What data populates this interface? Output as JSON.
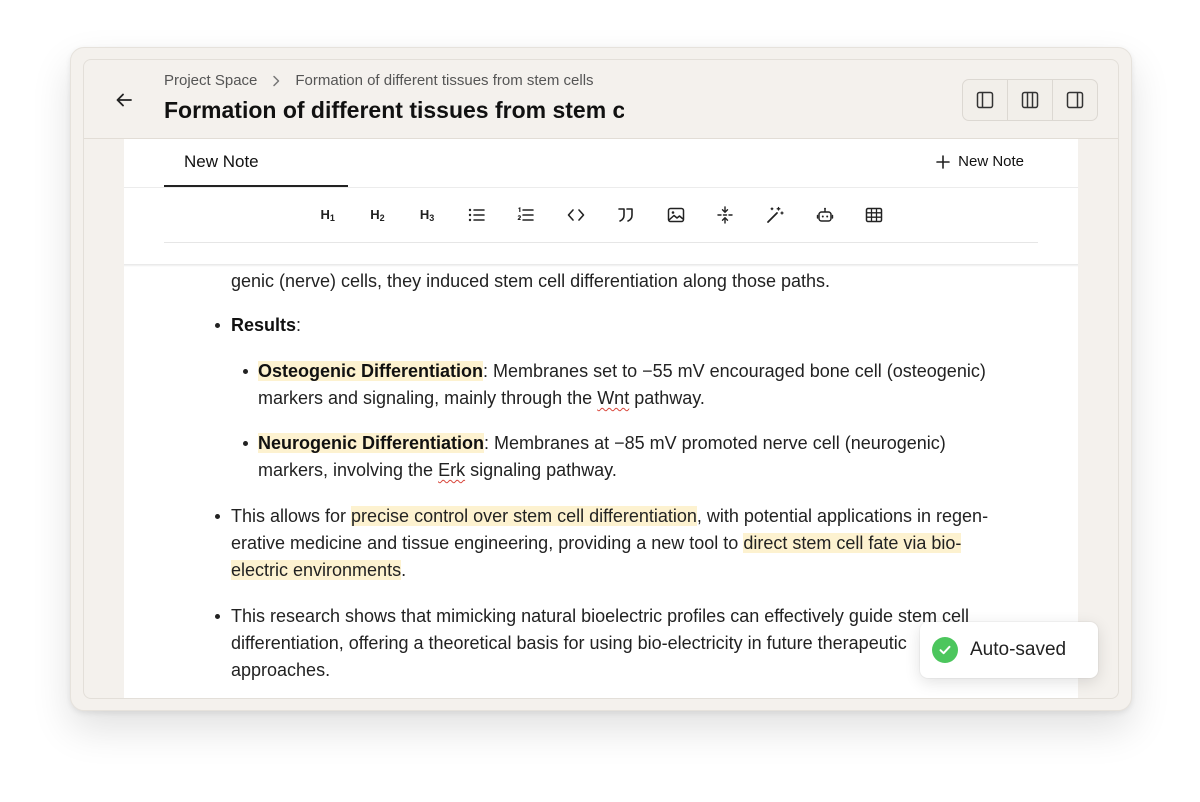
{
  "header": {
    "breadcrumb": [
      "Project Space",
      "Formation of different tissues from stem cells"
    ],
    "title": "Formation of different tissues from stem cells"
  },
  "layout_buttons": [
    "sidebar-left-icon",
    "columns-icon",
    "sidebar-right-icon"
  ],
  "tabs": [
    {
      "label": "New Note",
      "active": true
    }
  ],
  "new_note_label": "New Note",
  "toolbar": {
    "h1": "H",
    "h1_sub": "1",
    "h2": "H",
    "h2_sub": "2",
    "h3": "H",
    "h3_sub": "3",
    "icons": [
      "bullet-list-icon",
      "numbered-list-icon",
      "code-icon",
      "quote-icon",
      "image-icon",
      "divider-icon",
      "magic-wand-icon",
      "robot-icon",
      "table-icon"
    ]
  },
  "content": {
    "l1": "genic (nerve) cells, they induced stem cell differentiation along those paths.",
    "results_label": "Results",
    "results_colon": ":",
    "osteo_label": "Osteogenic Differentiation",
    "osteo_rest": ": Membranes set to −55 mV encouraged bone cell (osteogenic)",
    "osteo_l2a": "markers and signaling, mainly through the ",
    "osteo_l2b": "Wnt",
    "osteo_l2c": " pathway.",
    "neuro_label": "Neurogenic Differentiation",
    "neuro_rest": ": Membranes at −85 mV promoted nerve cell (neurogenic)",
    "neuro_l2a": "markers, involving the ",
    "neuro_l2b": "Erk",
    "neuro_l2c": " signaling pathway.",
    "p1_a": "This allows for ",
    "p1_hl": "precise control over stem cell differentiation",
    "p1_b": ", with potential applications in regen-",
    "p1_l2a": "erative medicine and tissue engineering, providing a new tool to ",
    "p1_l2hl": "direct stem cell fate via bio-",
    "p1_l3hl": "electric environments",
    "p1_l3b": ".",
    "p2_l1": "This research shows that mimicking natural bioelectric profiles can effectively guide stem cell",
    "p2_l2": "differentiation, offering a theoretical basis for using bio-electricity in future therapeutic",
    "p2_l3": "approaches."
  },
  "toast": {
    "message": "Auto-saved"
  },
  "colors": {
    "highlight": "#fdf2d0",
    "success": "#4cc65d",
    "chrome": "#f4f1ed"
  }
}
